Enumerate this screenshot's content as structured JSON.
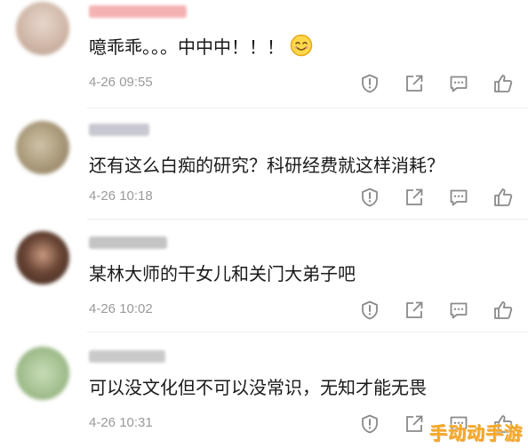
{
  "comments": [
    {
      "text": "噫乖乖。。。中中中！！！",
      "emoji": "smile-emoji",
      "time": "4-26 09:55",
      "avatar_color": "#d7c3b6",
      "name_color": "#f2a7a7"
    },
    {
      "text": "还有这么白痴的研究？科研经费就这样消耗？",
      "time": "4-26 10:18",
      "avatar_color": "#b8a98e",
      "name_color": "#c8c8d0"
    },
    {
      "text": "某林大师的干女儿和关门大弟子吧",
      "time": "4-26 10:02",
      "avatar_color": "#5a3a2e",
      "name_color": "#c0c0c0"
    },
    {
      "text": "可以没文化但不可以没常识，无知才能无畏",
      "time": "4-26 10:31",
      "avatar_color": "#a8c49a",
      "name_color": "#c8c8c8"
    }
  ],
  "actions": [
    "report-icon",
    "forward-icon",
    "reply-icon",
    "like-icon"
  ],
  "watermark": "手动动手游",
  "colors": {
    "text": "#1a1a1a",
    "meta": "#9a9a9a",
    "icon": "#8a8a8a",
    "watermark": "#f5a623"
  }
}
